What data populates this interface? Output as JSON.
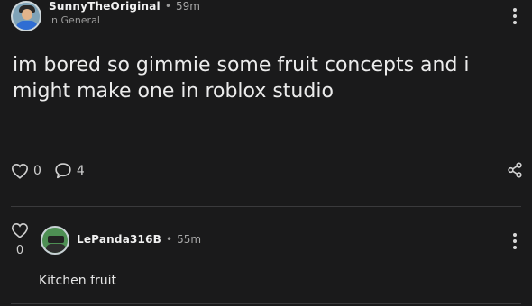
{
  "post": {
    "author": "SunnyTheOriginal",
    "separator": "•",
    "time": "59m",
    "category": "in General",
    "body": "im bored so gimmie some fruit concepts and i might make one in roblox studio",
    "likes": "0",
    "comments": "4"
  },
  "reply": {
    "likes": "0",
    "author": "LePanda316B",
    "separator": "•",
    "time": "55m",
    "text": "Kitchen fruit"
  },
  "icons": {
    "like": "heart-outline-icon",
    "comment": "speech-bubble-icon",
    "share": "share-icon",
    "menu": "vertical-ellipsis-icon"
  },
  "colors": {
    "background": "#1a1a1b",
    "text": "#e9e9ea",
    "muted": "#9a9a9a",
    "divider": "#3a3a3c"
  }
}
